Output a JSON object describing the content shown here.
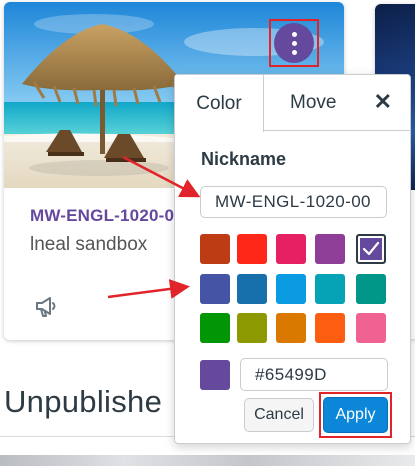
{
  "card": {
    "course_code": "MW-ENGL-1020-0",
    "subtitle": "lneal sandbox",
    "image_icon": "beach-umbrella-image",
    "menu_icon": "kebab-menu-icon",
    "announcement_icon": "megaphone-icon",
    "accent_color": "#65499D"
  },
  "section": {
    "title": "Unpublishe"
  },
  "popover": {
    "tabs": [
      "Color",
      "Move"
    ],
    "close_label": "✕",
    "nickname_label": "Nickname",
    "nickname_value": "MW-ENGL-1020-00",
    "swatches": [
      {
        "color": "#BD3C14",
        "selected": false
      },
      {
        "color": "#FF2717",
        "selected": false
      },
      {
        "color": "#E71F63",
        "selected": false
      },
      {
        "color": "#8F3E97",
        "selected": false
      },
      {
        "color": "#65499D",
        "selected": true
      },
      {
        "color": "#4554A4",
        "selected": false
      },
      {
        "color": "#1770AB",
        "selected": false
      },
      {
        "color": "#0B9BE3",
        "selected": false
      },
      {
        "color": "#06A3B7",
        "selected": false
      },
      {
        "color": "#009688",
        "selected": false
      },
      {
        "color": "#009606",
        "selected": false
      },
      {
        "color": "#8D9900",
        "selected": false
      },
      {
        "color": "#D97900",
        "selected": false
      },
      {
        "color": "#FD5D10",
        "selected": false
      },
      {
        "color": "#F06291",
        "selected": false
      }
    ],
    "selected_icon": "checkmark-icon",
    "hex_value": "#65499D",
    "cancel_label": "Cancel",
    "apply_label": "Apply"
  },
  "colors": {
    "annotation_red": "#e0242a",
    "apply_blue": "#0b86d9",
    "text_dark": "#2d3b45"
  }
}
